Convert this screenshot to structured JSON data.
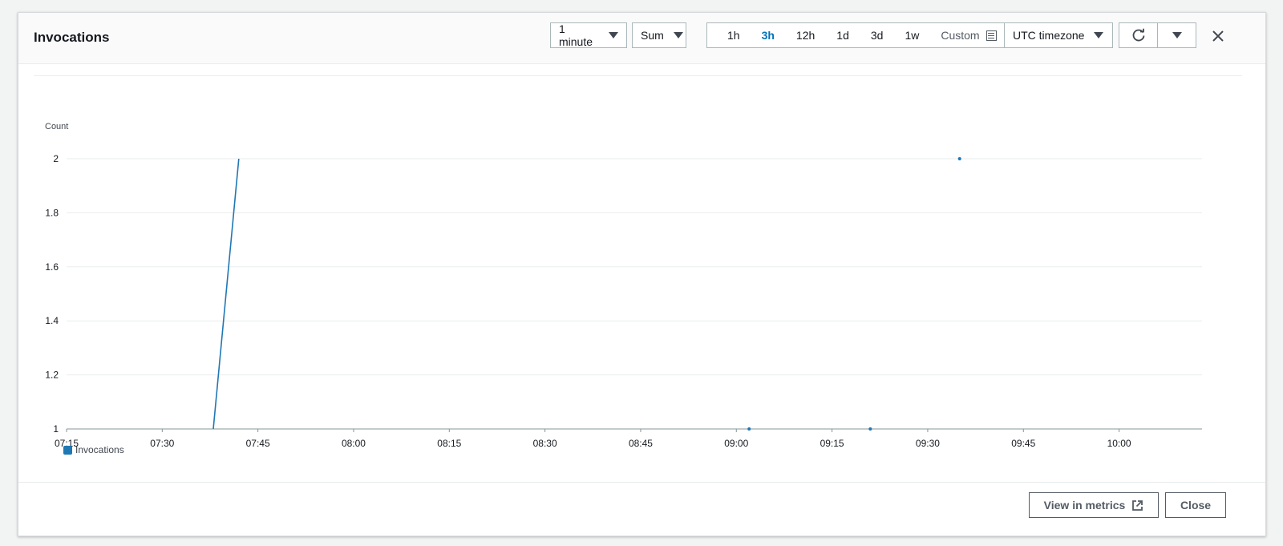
{
  "modal": {
    "title": "Invocations",
    "period": "1 minute",
    "statistic": "Sum",
    "ranges": [
      {
        "label": "1h",
        "active": false
      },
      {
        "label": "3h",
        "active": true
      },
      {
        "label": "12h",
        "active": false
      },
      {
        "label": "1d",
        "active": false
      },
      {
        "label": "3d",
        "active": false
      },
      {
        "label": "1w",
        "active": false
      }
    ],
    "custom_label": "Custom",
    "timezone": "UTC timezone",
    "refresh_icon": "refresh-icon",
    "more_icon": "chevron-down-icon",
    "close_icon": "close-icon"
  },
  "footer": {
    "view_in_metrics": "View in metrics",
    "external_icon": "external-link-icon",
    "close": "Close"
  },
  "colors": {
    "accent": "#0073bb",
    "series": "#1f77b4"
  },
  "chart_data": {
    "type": "line",
    "ylabel": "Count",
    "ylim": [
      1,
      2
    ],
    "yticks": [
      1,
      1.2,
      1.4,
      1.6,
      1.8,
      2
    ],
    "xlim": [
      "07:15",
      "10:13"
    ],
    "xticks": [
      "07:15",
      "07:30",
      "07:45",
      "08:00",
      "08:15",
      "08:30",
      "08:45",
      "09:00",
      "09:15",
      "09:30",
      "09:45",
      "10:00"
    ],
    "legend": "bottom-left",
    "series": [
      {
        "name": "Invocations",
        "segments": [
          [
            [
              "07:38",
              1
            ],
            [
              "07:42",
              2
            ]
          ],
          [
            [
              "09:02",
              1
            ]
          ],
          [
            [
              "09:21",
              1
            ]
          ],
          [
            [
              "09:35",
              2
            ]
          ]
        ]
      }
    ]
  }
}
